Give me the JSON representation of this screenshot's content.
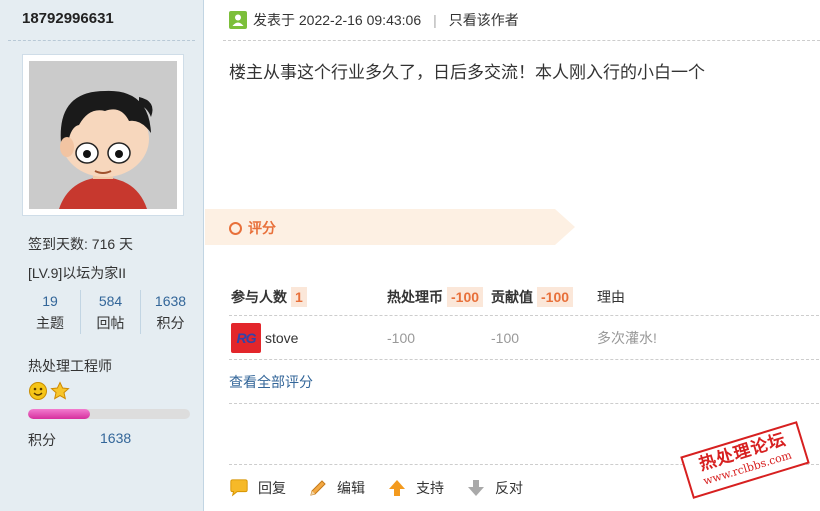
{
  "author": {
    "username": "18792996631",
    "signin_text": "签到天数: 716 天",
    "level_text": "[LV.9]以坛为家II",
    "stats": [
      {
        "value": "19",
        "label": "主题"
      },
      {
        "value": "584",
        "label": "回帖"
      },
      {
        "value": "1638",
        "label": "积分"
      }
    ],
    "title": "热处理工程师",
    "medals": [
      "smile-medal-icon",
      "star-medal-icon"
    ],
    "progress_fraction": 0.38,
    "points_label": "积分",
    "points_value": "1638"
  },
  "post": {
    "posted_prefix": "发表于",
    "posted_time": "2022-2-16 09:43:06",
    "separator": "|",
    "author_only": "只看该作者",
    "content": "楼主从事这个行业多久了，日后多交流！本人刚入行的小白一个"
  },
  "rating": {
    "title": "评分",
    "participants_label": "参与人数",
    "participants_count": "1",
    "col1_label": "热处理币",
    "col1_total": "-100",
    "col2_label": "贡献值",
    "col2_total": "-100",
    "reason_label": "理由",
    "rows": [
      {
        "logo": "RG",
        "name": "stove",
        "col1": "-100",
        "col2": "-100",
        "reason": "多次灌水!"
      }
    ],
    "view_all": "查看全部评分"
  },
  "actions": {
    "reply": "回复",
    "edit": "编辑",
    "support": "支持",
    "oppose": "反对"
  },
  "watermark": {
    "line1": "热处理论坛",
    "line2": "www.rclbbs.com"
  },
  "colors": {
    "sidebar_bg": "#e5edf2",
    "accent_orange": "#e8703a",
    "link_blue": "#336699",
    "progress_pink": "#d62f9e",
    "stamp_red": "#d72020"
  }
}
